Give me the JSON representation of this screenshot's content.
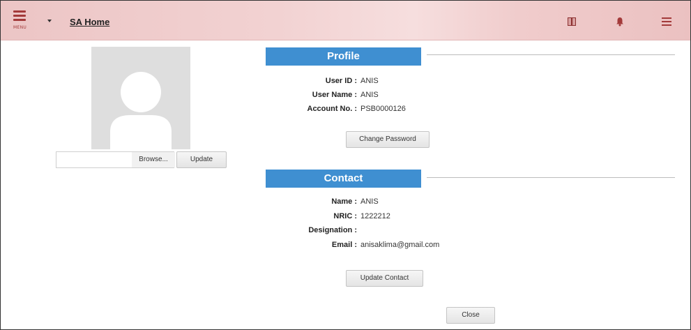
{
  "header": {
    "menu_label": "MENU",
    "home_link": "SA Home",
    "icons": [
      "menu-icon",
      "caret-down-icon",
      "book-icon",
      "bell-icon",
      "hamburger-icon"
    ],
    "accent_color": "#a33a3a"
  },
  "photo": {
    "browse_label": "Browse...",
    "update_label": "Update"
  },
  "profile": {
    "title": "Profile",
    "fields": [
      {
        "label": "User ID :",
        "value": "ANIS"
      },
      {
        "label": "User Name :",
        "value": "ANIS"
      },
      {
        "label": "Account No. :",
        "value": "PSB0000126"
      }
    ],
    "change_password_label": "Change Password"
  },
  "contact": {
    "title": "Contact",
    "fields": [
      {
        "label": "Name :",
        "value": "ANIS"
      },
      {
        "label": "NRIC :",
        "value": "1222212"
      },
      {
        "label": "Designation :",
        "value": ""
      },
      {
        "label": "Email :",
        "value": "anisaklima@gmail.com"
      }
    ],
    "update_contact_label": "Update Contact"
  },
  "footer": {
    "close_label": "Close"
  },
  "colors": {
    "section_bar": "#3f8fd1",
    "header_bg": "#f2d2d2"
  }
}
